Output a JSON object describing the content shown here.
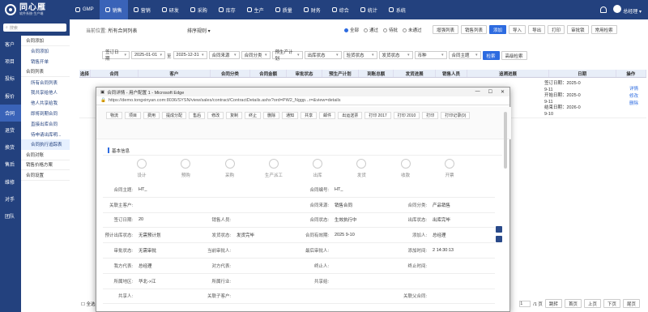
{
  "app": {
    "name": "同心雁",
    "sub": "软件系统·生产端",
    "user": "总经理"
  },
  "nav": [
    "GMP",
    "销售",
    "营销",
    "研发",
    "采购",
    "库存",
    "生产",
    "质量",
    "财务",
    "综合",
    "统计",
    "系统"
  ],
  "rail": [
    "客户",
    "项目",
    "投标",
    "报价",
    "合同",
    "退货",
    "换货",
    "售后",
    "维修",
    "对手",
    "团队"
  ],
  "menu": [
    {
      "t": "合同添加",
      "c": "grp"
    },
    {
      "t": "合同添加",
      "c": "sub"
    },
    {
      "t": "销售开单",
      "c": "sub"
    },
    {
      "t": "合同列表",
      "c": "grp"
    },
    {
      "t": "所有合同列表",
      "c": "sub"
    },
    {
      "t": "我共享给他人",
      "c": "sub"
    },
    {
      "t": "他人共享给我",
      "c": "sub"
    },
    {
      "t": "即将到期合同",
      "c": "sub"
    },
    {
      "t": "直接出库合同",
      "c": "sub"
    },
    {
      "t": "待申请出库明...",
      "c": "sub"
    },
    {
      "t": "合同执行追踪表",
      "c": "sub sel"
    },
    {
      "t": "合同对账",
      "c": "grp"
    },
    {
      "t": "销售价格方案",
      "c": "grp"
    },
    {
      "t": "合同设置",
      "c": "grp"
    }
  ],
  "search_placeholder": "搜索",
  "crumb_label": "当前位置:",
  "crumb_value": "所有合同列表",
  "sort": "排序规则",
  "radios": [
    "全部",
    "通过",
    "待批",
    "未通过"
  ],
  "toolbar": [
    "增强列表",
    "销售列表",
    "添加",
    "导入",
    "导出",
    "打印",
    "审批锁",
    "常用检索"
  ],
  "filters": [
    "签订日期",
    "2025-01-01",
    "至",
    "2025-12-31",
    "合同来源",
    "合同分类",
    "预生产计划",
    "出库状态",
    "验货状态",
    "发货状态",
    "币种",
    "合同主题",
    "检索",
    "高级检索"
  ],
  "cols": [
    "选择",
    "合同",
    "客户",
    "合同分类",
    "合同金额",
    "审批状态",
    "预生产计划",
    "到账总额",
    "发货进展",
    "销售人员",
    "追溯进展",
    "日期",
    "操作"
  ],
  "row": {
    "dates": [
      "签订日期：2025-0",
      "9-11",
      "开始日期：2025-0",
      "9-11",
      "结束日期：2026-0",
      "9-10"
    ],
    "ops": [
      "详情",
      "修改",
      "删除"
    ]
  },
  "pager": {
    "all": "全选",
    "page": "1",
    "total": "/1 页",
    "btns": [
      "跳转",
      "首页",
      "上页",
      "下页",
      "尾页"
    ]
  },
  "popup": {
    "title": "合同详情 - 用户配置 1 - Microsoft Edge",
    "url": "https://demo.tongxinyan.com:8036/SYSN/view/sales/contract/ContractDetails.ashx?ord=PW2_Nggp...r=&view=details",
    "tools": [
      "物流",
      "项目",
      "费用",
      "提成分配",
      "售后",
      "修改",
      "复制",
      "终止",
      "删除",
      "通知",
      "共享",
      "邮件",
      "出运送票",
      "打印 2017",
      "打印 2010",
      "打印",
      "打印记录(0)"
    ],
    "section": "基本信息",
    "steps": [
      "设计",
      "预购",
      "采购",
      "生产派工",
      "出库",
      "发货",
      "收款",
      "开票"
    ],
    "rows": [
      [
        "合同主题:",
        "HT_",
        "",
        "",
        "合同编号:",
        "HT_",
        "",
        ""
      ],
      [
        "关联主客户:",
        "",
        "",
        "",
        "合同来源:",
        "销售合同",
        "合同分类:",
        "产品销售"
      ],
      [
        "签订日期:",
        "20",
        "销售人员:",
        "",
        "合同状态:",
        "生效执行中",
        "出库状态:",
        "出库完毕"
      ],
      [
        "预计出库状态:",
        "无需预计划",
        "发货状态:",
        "发货完毕",
        "合同有效期:",
        "2025 9-10",
        "添加人:",
        "总经理"
      ],
      [
        "审批状态:",
        "无需审批",
        "当前审批人:",
        "",
        "最后审批人:",
        "",
        "添加时间:",
        "2 14:30:13"
      ],
      [
        "我方代表:",
        "总经理",
        "对方代表:",
        "",
        "终止人:",
        "",
        "终止时间:",
        ""
      ],
      [
        "所属地区:",
        "华北->江",
        "所属行业:",
        "",
        "共享给:",
        "",
        "",
        ""
      ],
      [
        "共享人:",
        "",
        "关联子客户:",
        "",
        "",
        "",
        "关联父合同:",
        ""
      ]
    ]
  }
}
